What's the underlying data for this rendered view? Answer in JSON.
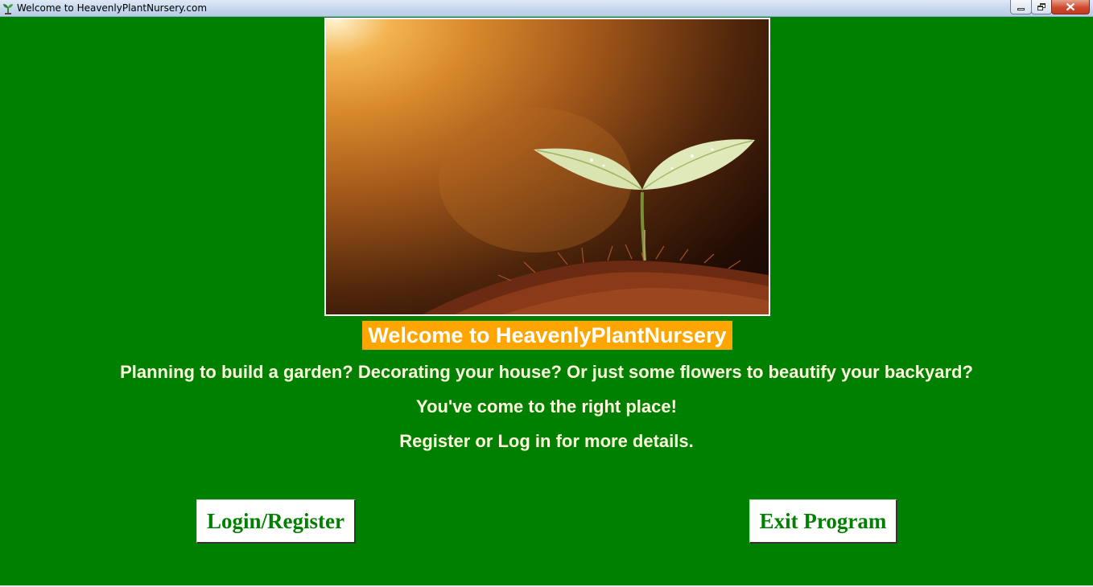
{
  "window": {
    "title": "Welcome to HeavenlyPlantNursery.com",
    "icon": "seedling-icon",
    "controls": [
      "minimize-icon",
      "restore-icon",
      "close-icon"
    ]
  },
  "hero": {
    "image": "seedling-in-soil-photo"
  },
  "content": {
    "welcome_title": "Welcome to HeavenlyPlantNursery",
    "line1": "Planning to build a garden? Decorating your house? Or just some flowers to beautify your backyard?",
    "line2": "You've come to the right place!",
    "line3": "Register or Log in for more details."
  },
  "buttons": {
    "login_label": "Login/Register",
    "exit_label": "Exit Program"
  },
  "colors": {
    "background": "#008000",
    "welcome_bg": "#ffa500",
    "text": "#ffffe0",
    "button_text": "#008000"
  }
}
